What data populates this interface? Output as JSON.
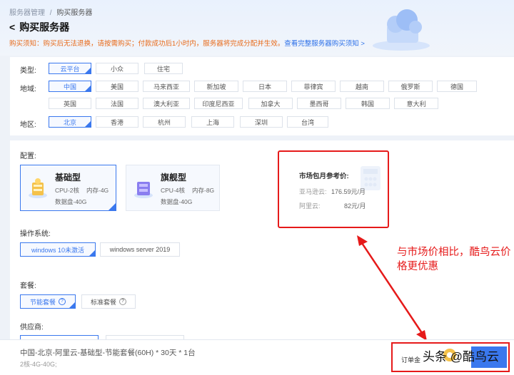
{
  "breadcrumb": {
    "parent": "服务器管理",
    "sep": "/",
    "current": "购买服务器"
  },
  "page_title": "购买服务器",
  "notice": {
    "text": "购买须知：购买后无法退换，请按需购买；付款成功后1小时内，服务器将完成分配并生效。",
    "link": "查看完整服务器购买须知 >"
  },
  "filters": {
    "type": {
      "label": "类型:",
      "options": [
        "云平台",
        "小众",
        "住宅"
      ],
      "selected": "云平台"
    },
    "region": {
      "label": "地域:",
      "row1": [
        "中国",
        "美国",
        "马来西亚",
        "新加坡",
        "日本",
        "菲律宾",
        "越南",
        "俄罗斯",
        "德国"
      ],
      "row2": [
        "英国",
        "法国",
        "澳大利亚",
        "印度尼西亚",
        "加拿大",
        "墨西哥",
        "韩国",
        "意大利"
      ],
      "selected": "中国"
    },
    "area": {
      "label": "地区:",
      "options": [
        "北京",
        "香港",
        "杭州",
        "上海",
        "深圳",
        "台湾"
      ],
      "selected": "北京"
    }
  },
  "config": {
    "label": "配置:",
    "cards": [
      {
        "title": "基础型",
        "cpu": "CPU-2核",
        "mem": "内存-4G",
        "disk": "数据盘-40G",
        "selected": true
      },
      {
        "title": "旗舰型",
        "cpu": "CPU-4核",
        "mem": "内存-8G",
        "disk": "数据盘-40G",
        "selected": false
      }
    ]
  },
  "market": {
    "title": "市场包月参考价:",
    "rows": [
      {
        "name": "亚马逊云:",
        "price": "176.59元/月"
      },
      {
        "name": "阿里云:",
        "price": "82元/月"
      }
    ]
  },
  "os": {
    "label": "操作系统:",
    "options": [
      "windows 10未激活",
      "windows server 2019"
    ],
    "selected": "windows 10未激活"
  },
  "package": {
    "label": "套餐:",
    "options": [
      "节能套餐",
      "标准套餐"
    ],
    "selected": "节能套餐"
  },
  "supplier": {
    "label": "供应商:"
  },
  "annotation": "与市场价相比，酷鸟云价格更优惠",
  "summary": {
    "title": "中国-北京-阿里云-基础型-节能套餐(60H) * 30天 * 1台",
    "spec": "2核-4G-40G;"
  },
  "order": {
    "label": "订单金",
    "watermark": "头条 @酷鸟云"
  },
  "colors": {
    "accent": "#3a78ee",
    "warning": "#e86a1a",
    "annotation": "#e61a1a"
  }
}
